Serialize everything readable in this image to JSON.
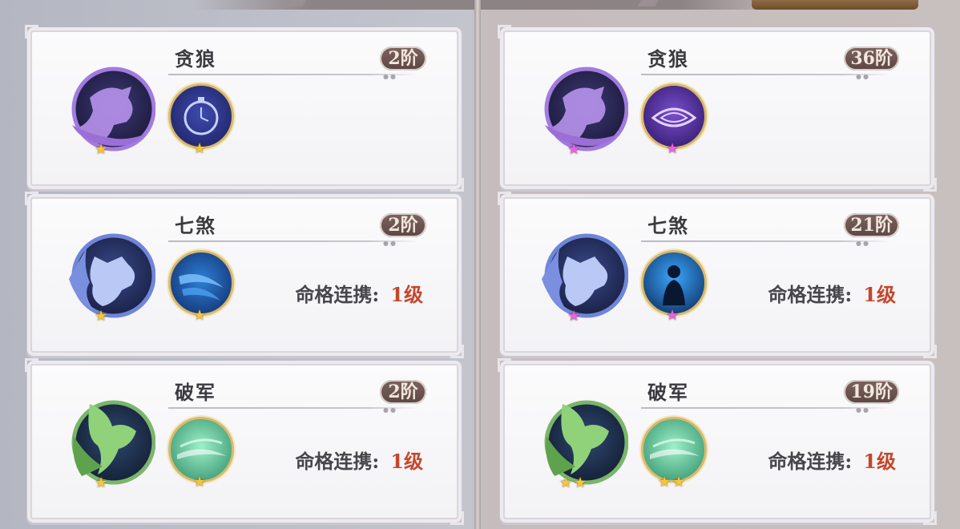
{
  "header": {
    "title": "",
    "button_label": ""
  },
  "labels": {
    "link_label": "命格连携:"
  },
  "left_column": {
    "cards": [
      {
        "name": "贪狼",
        "rank": "2阶",
        "link_level": "",
        "emblem_icon": "purple-wolf-emblem-icon",
        "skill_icon": "stopwatch-skill-icon",
        "stars": 1
      },
      {
        "name": "七煞",
        "rank": "2阶",
        "link_level": "1级",
        "emblem_icon": "blue-beast-emblem-icon",
        "skill_icon": "blue-slash-skill-icon",
        "stars": 1
      },
      {
        "name": "破军",
        "rank": "2阶",
        "link_level": "1级",
        "emblem_icon": "green-dragon-emblem-icon",
        "skill_icon": "green-wind-skill-icon",
        "stars": 1
      }
    ]
  },
  "right_column": {
    "cards": [
      {
        "name": "贪狼",
        "rank": "36阶",
        "link_level": "",
        "emblem_icon": "purple-wolf-emblem-icon",
        "skill_icon": "purple-eye-skill-icon",
        "stars": 1
      },
      {
        "name": "七煞",
        "rank": "21阶",
        "link_level": "1级",
        "emblem_icon": "blue-beast-emblem-icon",
        "skill_icon": "silhouette-skill-icon",
        "stars": 1
      },
      {
        "name": "破军",
        "rank": "19阶",
        "link_level": "1级",
        "emblem_icon": "green-dragon-emblem-icon",
        "skill_icon": "green-wind-skill-icon",
        "stars": 2
      }
    ]
  },
  "colors": {
    "rank_badge": "#6b5250",
    "link_level": "#c4472b",
    "star_gold": "#f6c53a",
    "star_pink": "#e565d9",
    "wolf_purple": "#9b6fd6",
    "beast_blue": "#7a8fe0",
    "dragon_green": "#7fc86a"
  }
}
